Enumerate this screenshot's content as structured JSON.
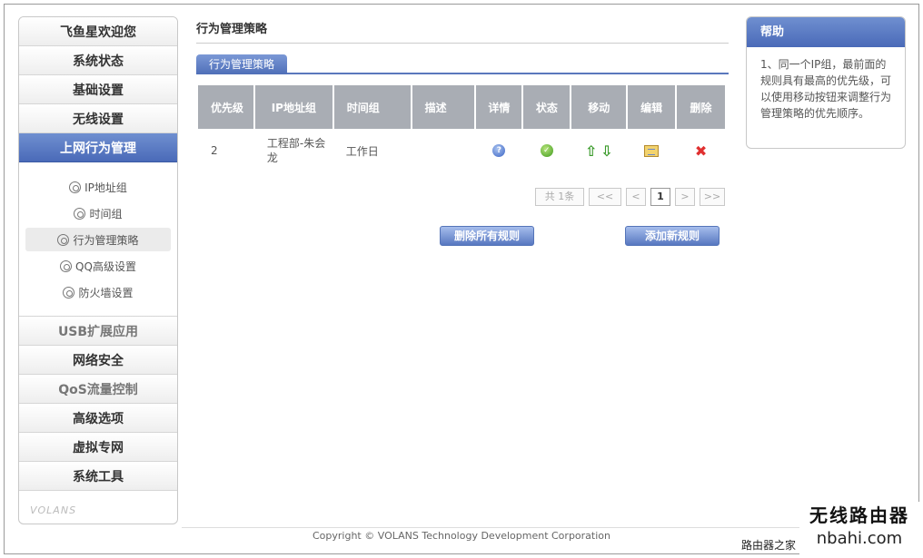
{
  "sidebar": {
    "top_items": [
      {
        "label": "飞鱼星欢迎您"
      },
      {
        "label": "系统状态"
      },
      {
        "label": "基础设置"
      },
      {
        "label": "无线设置"
      },
      {
        "label": "上网行为管理"
      }
    ],
    "sub_items": [
      {
        "label": "IP地址组"
      },
      {
        "label": "时间组"
      },
      {
        "label": "行为管理策略"
      },
      {
        "label": "QQ高级设置"
      },
      {
        "label": "防火墙设置"
      }
    ],
    "bottom_items": [
      {
        "label": "USB扩展应用"
      },
      {
        "label": "网络安全"
      },
      {
        "label": "QoS流量控制"
      },
      {
        "label": "高级选项"
      },
      {
        "label": "虚拟专网"
      },
      {
        "label": "系统工具"
      }
    ],
    "logo_text": "VOLANS"
  },
  "main": {
    "title": "行为管理策略",
    "tab_label": "行为管理策略",
    "columns": [
      "优先级",
      "IP地址组",
      "时间组",
      "描述",
      "详情",
      "状态",
      "移动",
      "编辑",
      "删除"
    ],
    "rows": [
      {
        "priority": "2",
        "ip_group": "工程部-朱会龙",
        "time_group": "工作日",
        "description": ""
      }
    ],
    "pager": {
      "total": "共 1条",
      "first": "<<",
      "prev": "<",
      "current": "1",
      "next": ">",
      "last": ">>"
    },
    "delete_all_label": "删除所有规则",
    "add_label": "添加新规则"
  },
  "help": {
    "title": "帮助",
    "body": "1、同一个IP组，最前面的规则具有最高的优先级，可以使用移动按钮来调整行为管理策略的优先顺序。"
  },
  "footer": {
    "copyright": "Copyright © VOLANS Technology Development Corporation"
  },
  "watermark": {
    "line1": "无线路由器",
    "line2": "nbahi.com",
    "line3": "路由器之家"
  },
  "colors": {
    "accent": "#4a6ab8",
    "table_header": "#a9adb4"
  }
}
